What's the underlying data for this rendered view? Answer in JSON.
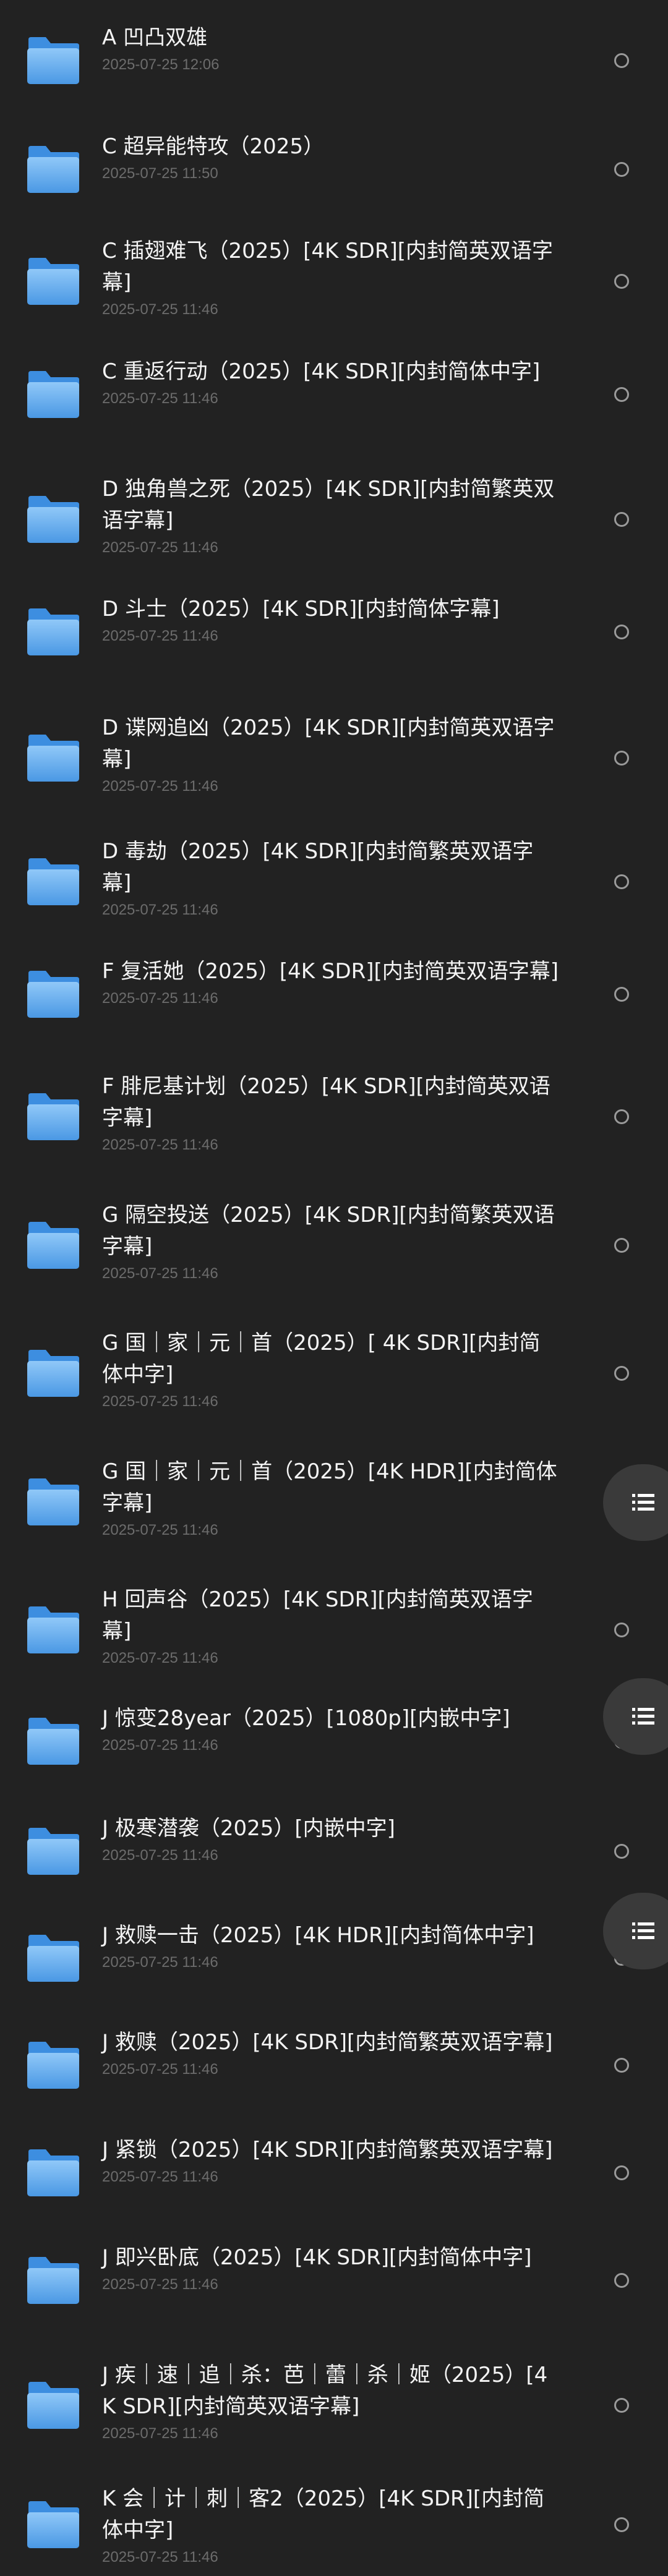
{
  "files": [
    {
      "name": "A 凹凸双雄",
      "date": "2025-07-25 12:06"
    },
    {
      "name": "C 超异能特攻（2025）",
      "date": "2025-07-25 11:50"
    },
    {
      "name": "C 插翅难飞（2025）[4K SDR][内封简英双语字幕]",
      "date": "2025-07-25 11:46"
    },
    {
      "name": "C 重返行动（2025）[4K SDR][内封简体中字]",
      "date": "2025-07-25 11:46"
    },
    {
      "name": "D 独角兽之死（2025）[4K SDR][内封简繁英双语字幕]",
      "date": "2025-07-25 11:46"
    },
    {
      "name": "D 斗士（2025）[4K SDR][内封简体字幕]",
      "date": "2025-07-25 11:46"
    },
    {
      "name": "D 谍网追凶（2025）[4K SDR][内封简英双语字幕]",
      "date": "2025-07-25 11:46"
    },
    {
      "name": "D 毒劫（2025）[4K SDR][内封简繁英双语字幕]",
      "date": "2025-07-25 11:46"
    },
    {
      "name": "F 复活她（2025）[4K SDR][内封简英双语字幕]",
      "date": "2025-07-25 11:46"
    },
    {
      "name": "F 腓尼基计划（2025）[4K SDR][内封简英双语字幕]",
      "date": "2025-07-25 11:46"
    },
    {
      "name": "G 隔空投送（2025）[4K SDR][内封简繁英双语字幕]",
      "date": "2025-07-25 11:46"
    },
    {
      "name": "G 国｜家｜元｜首（2025）[ 4K SDR][内封简体中字]",
      "date": "2025-07-25 11:46"
    },
    {
      "name": "G 国｜家｜元｜首（2025）[4K HDR][内封简体字幕]",
      "date": "2025-07-25 11:46"
    },
    {
      "name": "H 回声谷（2025）[4K SDR][内封简英双语字幕]",
      "date": "2025-07-25 11:46"
    },
    {
      "name": "J 惊变28year（2025）[1080p][内嵌中字]",
      "date": "2025-07-25 11:46"
    },
    {
      "name": "J 极寒潜袭（2025）[内嵌中字]",
      "date": "2025-07-25 11:46"
    },
    {
      "name": "J 救赎一击（2025）[4K HDR][内封简体中字]",
      "date": "2025-07-25 11:46"
    },
    {
      "name": "J 救赎（2025）[4K SDR][内封简繁英双语字幕]",
      "date": "2025-07-25 11:46"
    },
    {
      "name": "J 紧锁（2025）[4K SDR][内封简繁英双语字幕]",
      "date": "2025-07-25 11:46"
    },
    {
      "name": "J 即兴卧底（2025）[4K SDR][内封简体中字]",
      "date": "2025-07-25 11:46"
    },
    {
      "name": "J 疾｜速｜追｜杀：芭｜蕾｜杀｜姬（2025）[4K SDR][内封简英双语字幕]",
      "date": "2025-07-25 11:46"
    },
    {
      "name": "K 会｜计｜刺｜客2（2025）[4K SDR][内封简体中字]",
      "date": "2025-07-25 11:46"
    }
  ],
  "icons": {
    "folder": "folder-icon",
    "select": "radio-circle-icon",
    "menu": "menu-lines-icon"
  },
  "colors": {
    "background": "#222222",
    "folder_top": "#90c8f8",
    "folder_bottom": "#4a98e4",
    "date_text": "#6c6c6c"
  }
}
